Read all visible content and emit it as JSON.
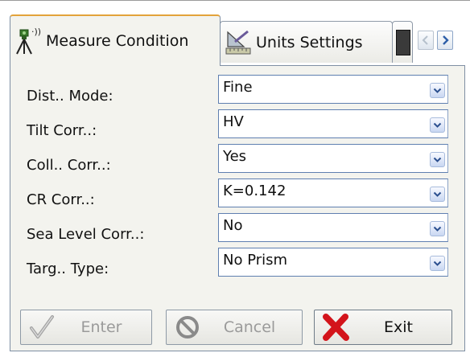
{
  "tabs": [
    {
      "label": "Measure Condition",
      "icon": "survey-instrument-icon",
      "active": true
    },
    {
      "label": "Units Settings",
      "icon": "ruler-triangle-icon",
      "active": false
    },
    {
      "label": "",
      "icon": "partial-tab-icon",
      "active": false
    }
  ],
  "settings": [
    {
      "label": "Dist.. Mode:",
      "value": "Fine"
    },
    {
      "label": "Tilt Corr..:",
      "value": "HV"
    },
    {
      "label": "Coll.. Corr..:",
      "value": "Yes"
    },
    {
      "label": "CR Corr..:",
      "value": "K=0.142"
    },
    {
      "label": "Sea Level Corr..:",
      "value": "No"
    },
    {
      "label": "Targ.. Type:",
      "value": "No Prism"
    }
  ],
  "buttons": {
    "enter": {
      "label": "Enter",
      "icon": "checkmark-icon",
      "enabled": false
    },
    "cancel": {
      "label": "Cancel",
      "icon": "no-entry-icon",
      "enabled": false
    },
    "exit": {
      "label": "Exit",
      "icon": "red-x-icon",
      "enabled": true
    }
  },
  "colors": {
    "panel": "#f3f3ee",
    "accent_blue": "#5f7fb0",
    "exit_red": "#d3141b",
    "disabled_text": "#9a9a9a"
  }
}
